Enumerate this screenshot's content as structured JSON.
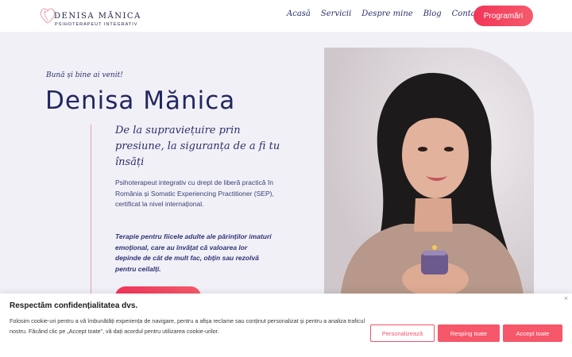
{
  "brand": {
    "name": "DENISA MĂNICA",
    "subtitle": "PSIHOTERAPEUT INTEGRATIV"
  },
  "nav": {
    "links": [
      "Acasă",
      "Servicii",
      "Despre mine",
      "Blog",
      "Contact"
    ],
    "cta_label": "Programări"
  },
  "hero": {
    "greeting": "Bună și bine ai venit!",
    "title": "Denisa Mănica",
    "tagline": "De la supraviețuire prin presiune, la siguranța de a fi tu însăți",
    "description": "Psihoterapeut integrativ cu drept de liberă practică în România și Somatic Experiencing Practitioner (SEP), certificat la nivel internațional.",
    "description_highlight": "Terapie pentru fiicele adulte ale părinților imaturi emoțional, care au învățat că valoarea lor depinde de cât de mult fac, obțin sau rezolvă pentru ceilalți."
  },
  "cookie_banner": {
    "title": "Respectăm confidențialitatea dvs.",
    "text": "Folosim cookie-uri pentru a vă îmbunătăți experiența de navigare, pentru a afișa reclame sau conținut personalizat și pentru a analiza traficul nostru. Făcând clic pe „Accept toate”, vă dați acordul pentru utilizarea cookie-urilor.",
    "close_glyph": "×",
    "buttons": {
      "customize": "Personalizează",
      "reject": "Resping toate",
      "accept": "Accept toate"
    }
  },
  "colors": {
    "accent": "#f2355a",
    "navy": "#2a2f6b",
    "background": "#f1f0f7"
  },
  "icons": [
    "logo-heart-icon",
    "close-icon"
  ]
}
